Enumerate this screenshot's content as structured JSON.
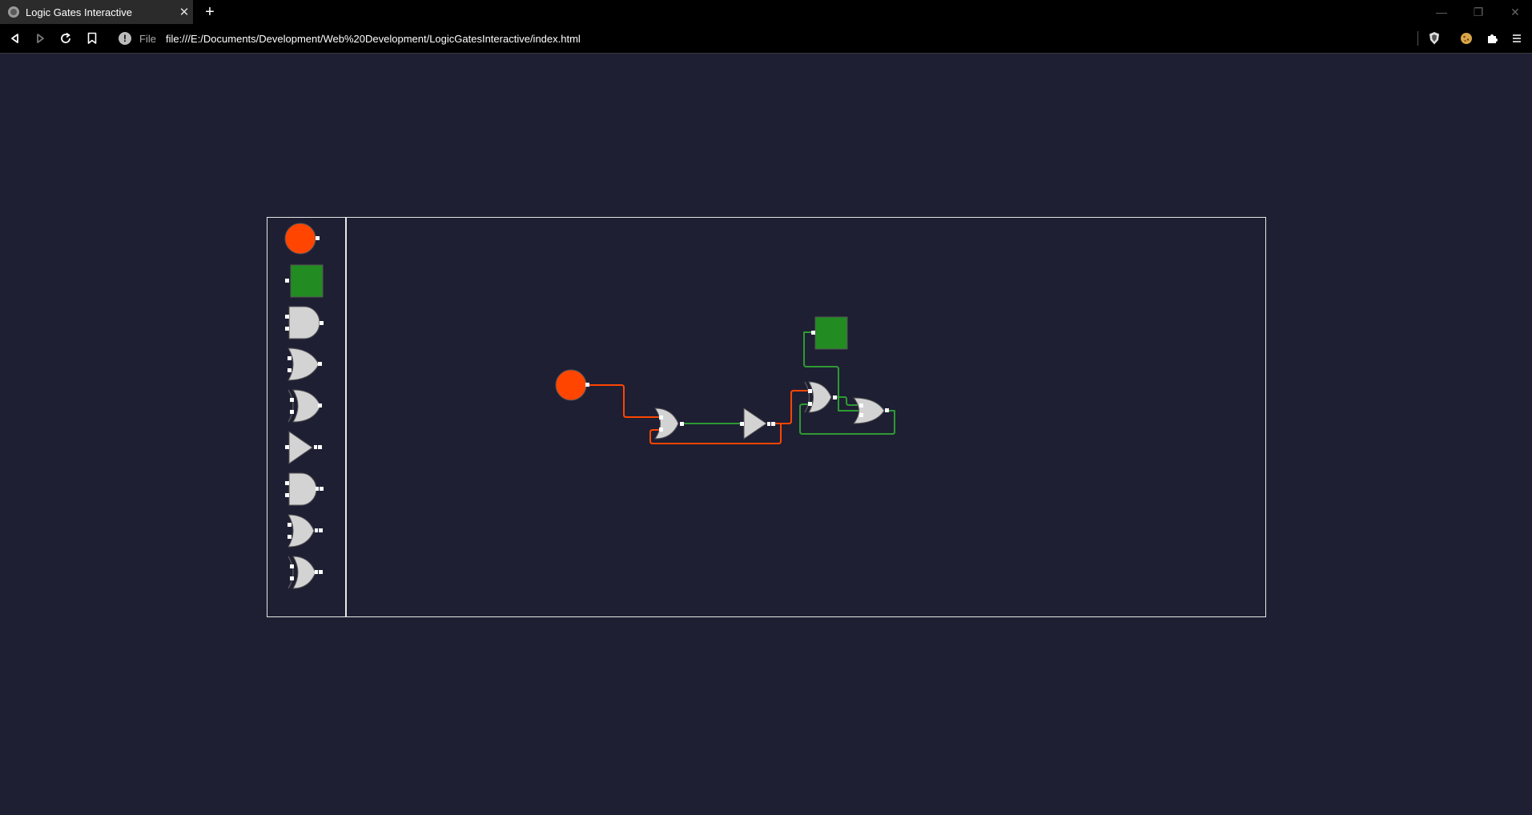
{
  "browser": {
    "tab_title": "Logic Gates Interactive",
    "tab_close": "✕",
    "new_tab": "+",
    "address_scheme": "File",
    "address_url": "file:///E:/Documents/Development/Web%20Development/LogicGatesInteractive/index.html",
    "window_controls": [
      "—",
      "❐",
      "✕"
    ]
  },
  "colors": {
    "background": "#1e1f33",
    "input_on": "#ff4500",
    "output_lamp": "#228b22",
    "gate_fill": "#d3d3d3",
    "wire_active": "#ff4500",
    "wire_green": "#2e9a32",
    "frame": "#e8e8e8"
  },
  "palette": [
    {
      "name": "input-switch",
      "icon": "orange-circle"
    },
    {
      "name": "output-lamp",
      "icon": "green-square"
    },
    {
      "name": "and-gate",
      "icon": "and-gate-icon"
    },
    {
      "name": "or-gate",
      "icon": "or-gate-icon"
    },
    {
      "name": "xor-gate",
      "icon": "xor-gate-icon"
    },
    {
      "name": "not-gate",
      "icon": "not-gate-icon"
    },
    {
      "name": "nand-gate",
      "icon": "nand-gate-icon"
    },
    {
      "name": "nor-gate",
      "icon": "nor-gate-icon"
    },
    {
      "name": "xnor-gate",
      "icon": "xnor-gate-icon"
    }
  ],
  "circuit": {
    "components": [
      {
        "id": "input-1",
        "type": "input",
        "state": "on"
      },
      {
        "id": "nor-1",
        "type": "nor"
      },
      {
        "id": "not-1",
        "type": "not"
      },
      {
        "id": "xor-1",
        "type": "xor"
      },
      {
        "id": "or-1",
        "type": "or"
      },
      {
        "id": "output-1",
        "type": "output"
      }
    ],
    "wires": [
      {
        "from": "input-1",
        "to": "nor-1",
        "color": "orange"
      },
      {
        "from": "nor-1",
        "to": "not-1",
        "color": "green"
      },
      {
        "from": "not-1",
        "to": "nor-1",
        "color": "orange"
      },
      {
        "from": "not-1",
        "to": "xor-1",
        "color": "orange"
      },
      {
        "from": "xor-1",
        "to": "or-1",
        "color": "green"
      },
      {
        "from": "or-1",
        "to": "xor-1",
        "color": "green"
      },
      {
        "from": "output-1",
        "to": "or-1",
        "color": "green"
      }
    ]
  }
}
